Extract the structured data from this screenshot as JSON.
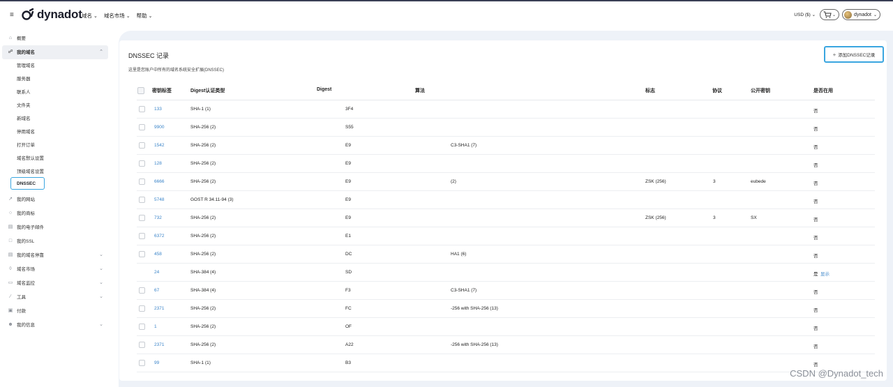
{
  "header": {
    "logo_text": "dynadot",
    "nav": [
      "域名",
      "域名市场",
      "帮助"
    ],
    "currency": "USD ($)",
    "account_name": "dynadot"
  },
  "sidebar": {
    "overview": "概要",
    "my_domains": "我的域名",
    "sub_items": [
      "管理域名",
      "服务器",
      "联系人",
      "文件夹",
      "新域名",
      "停用域名",
      "打开订单",
      "域名默认设置",
      "顶级域名设置",
      "DNSSEC"
    ],
    "items": [
      {
        "label": "我的网站",
        "icon": "link-icon",
        "chevron": false
      },
      {
        "label": "我的商标",
        "icon": "trademark-icon",
        "chevron": false
      },
      {
        "label": "我的电子邮件",
        "icon": "mail-icon",
        "chevron": false
      },
      {
        "label": "我的SSL",
        "icon": "lock-icon",
        "chevron": false
      },
      {
        "label": "我的域名停靠",
        "icon": "parking-icon",
        "chevron": true
      },
      {
        "label": "域名市场",
        "icon": "tag-icon",
        "chevron": true
      },
      {
        "label": "域名监控",
        "icon": "monitor-icon",
        "chevron": true
      },
      {
        "label": "工具",
        "icon": "wrench-icon",
        "chevron": true
      },
      {
        "label": "付款",
        "icon": "calendar-icon",
        "chevron": false
      },
      {
        "label": "我的信息",
        "icon": "user-icon",
        "chevron": true
      }
    ]
  },
  "main": {
    "title": "DNSSEC 记录",
    "subtitle": "这里是您账户中所有的域名系统安全扩展(DNSSEC)",
    "add_button": "添加DNSSEC记录",
    "columns": {
      "key_tag": "密钥标签",
      "digest_type": "Digest认证类型",
      "digest": "Digest",
      "algorithm": "算法",
      "flags": "标志",
      "protocol": "协议",
      "public_key": "公开密钥",
      "in_use": "是否在用"
    },
    "rows": [
      {
        "key_tag": "133",
        "digest_type": "SHA-1 (1)",
        "digest": "3F4",
        "algorithm": "",
        "flags": "",
        "protocol": "",
        "public_key": "",
        "in_use": "否",
        "show": "",
        "checkbox": true
      },
      {
        "key_tag": "9900",
        "digest_type": "SHA-256 (2)",
        "digest": "S55",
        "algorithm": "",
        "flags": "",
        "protocol": "",
        "public_key": "",
        "in_use": "否",
        "show": "",
        "checkbox": true
      },
      {
        "key_tag": "1542",
        "digest_type": "SHA-256 (2)",
        "digest": "E9",
        "algorithm": "C3-SHA1 (7)",
        "flags": "",
        "protocol": "",
        "public_key": "",
        "in_use": "否",
        "show": "",
        "checkbox": true
      },
      {
        "key_tag": "128",
        "digest_type": "SHA-256 (2)",
        "digest": "E9",
        "algorithm": "",
        "flags": "",
        "protocol": "",
        "public_key": "",
        "in_use": "否",
        "show": "",
        "checkbox": true
      },
      {
        "key_tag": "6666",
        "digest_type": "SHA-256 (2)",
        "digest": "E9",
        "algorithm": "(2)",
        "flags": "ZSK (256)",
        "protocol": "3",
        "public_key": "eubede",
        "in_use": "否",
        "show": "",
        "checkbox": true
      },
      {
        "key_tag": "5748",
        "digest_type": "GOST R 34.11-94 (3)",
        "digest": "E9",
        "algorithm": "",
        "flags": "",
        "protocol": "",
        "public_key": "",
        "in_use": "否",
        "show": "",
        "checkbox": true
      },
      {
        "key_tag": "732",
        "digest_type": "SHA-256 (2)",
        "digest": "E9",
        "algorithm": "",
        "flags": "ZSK (256)",
        "protocol": "3",
        "public_key": "SX",
        "in_use": "否",
        "show": "",
        "checkbox": true
      },
      {
        "key_tag": "6372",
        "digest_type": "SHA-256 (2)",
        "digest": "E1",
        "algorithm": "",
        "flags": "",
        "protocol": "",
        "public_key": "",
        "in_use": "否",
        "show": "",
        "checkbox": true
      },
      {
        "key_tag": "458",
        "digest_type": "SHA-256 (2)",
        "digest": "DC",
        "algorithm": "HA1 (6)",
        "flags": "",
        "protocol": "",
        "public_key": "",
        "in_use": "否",
        "show": "",
        "checkbox": true
      },
      {
        "key_tag": "24",
        "digest_type": "SHA-384 (4)",
        "digest": "SD",
        "algorithm": "",
        "flags": "",
        "protocol": "",
        "public_key": "",
        "in_use": "是",
        "show": "显示",
        "checkbox": false
      },
      {
        "key_tag": "67",
        "digest_type": "SHA-384 (4)",
        "digest": "F3",
        "algorithm": "C3-SHA1 (7)",
        "flags": "",
        "protocol": "",
        "public_key": "",
        "in_use": "否",
        "show": "",
        "checkbox": true
      },
      {
        "key_tag": "2371",
        "digest_type": "SHA-256 (2)",
        "digest": "FC",
        "algorithm": "-256 with SHA-256 (13)",
        "flags": "",
        "protocol": "",
        "public_key": "",
        "in_use": "否",
        "show": "",
        "checkbox": true
      },
      {
        "key_tag": "1",
        "digest_type": "SHA-256 (2)",
        "digest": "OF",
        "algorithm": "",
        "flags": "",
        "protocol": "",
        "public_key": "",
        "in_use": "否",
        "show": "",
        "checkbox": true
      },
      {
        "key_tag": "2371",
        "digest_type": "SHA-256 (2)",
        "digest": "A22",
        "algorithm": "-256 with SHA-256 (13)",
        "flags": "",
        "protocol": "",
        "public_key": "",
        "in_use": "否",
        "show": "",
        "checkbox": true
      },
      {
        "key_tag": "99",
        "digest_type": "SHA-1 (1)",
        "digest": "B3",
        "algorithm": "",
        "flags": "",
        "protocol": "",
        "public_key": "",
        "in_use": "否",
        "show": "",
        "checkbox": true
      }
    ]
  },
  "watermark": "CSDN @Dynadot_tech"
}
